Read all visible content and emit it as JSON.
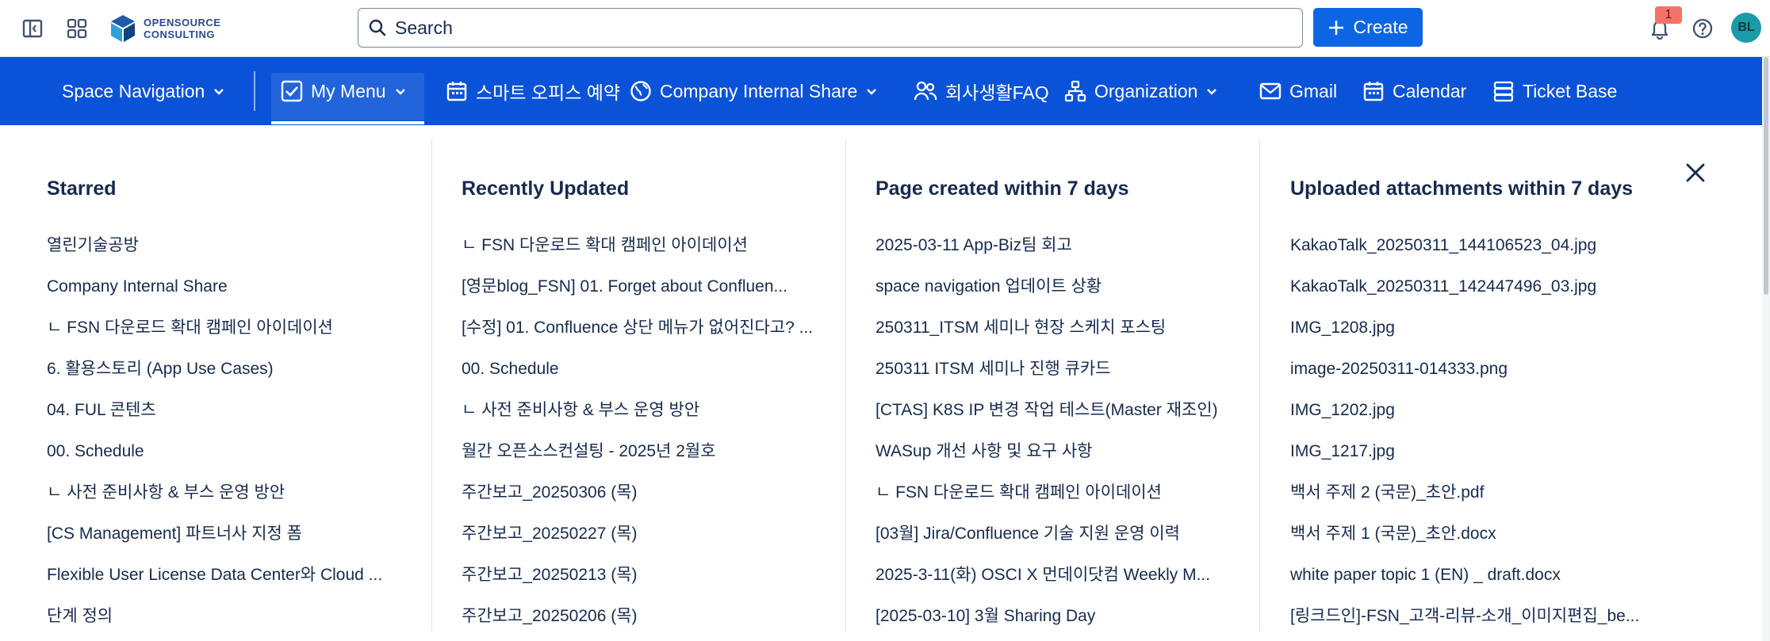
{
  "topbar": {
    "logo_line1": "OPENSOURCE",
    "logo_line2": "CONSULTING",
    "search_placeholder": "Search",
    "create_label": "Create",
    "notification_count": "1",
    "avatar_initials": "BL"
  },
  "nav": {
    "space_navigation": "Space Navigation",
    "my_menu": "My Menu",
    "smart_office": "스마트 오피스 예약",
    "company_internal_share": "Company Internal Share",
    "faq": "회사생활FAQ",
    "organization": "Organization",
    "gmail": "Gmail",
    "calendar": "Calendar",
    "ticket_base": "Ticket Base"
  },
  "columns": [
    {
      "title": "Starred",
      "items": [
        "열린기술공방",
        "Company Internal Share",
        "ㄴ FSN 다운로드 확대 캠페인 아이데이션",
        "6. 활용스토리 (App Use Cases)",
        "04. FUL 콘텐츠",
        "00. Schedule",
        "ㄴ 사전 준비사항 & 부스 운영 방안",
        "[CS Management] 파트너사 지정 폼",
        "Flexible User License Data Center와 Cloud ...",
        "단계 정의"
      ]
    },
    {
      "title": "Recently Updated",
      "items": [
        "ㄴ FSN 다운로드 확대 캠페인 아이데이션",
        "[영문blog_FSN] 01. Forget about Confluen...",
        "[수정] 01. Confluence 상단 메뉴가 없어진다고? ...",
        "00. Schedule",
        "ㄴ 사전 준비사항 & 부스 운영 방안",
        "월간 오픈소스컨설팅 - 2025년 2월호",
        "주간보고_20250306 (목)",
        "주간보고_20250227 (목)",
        "주간보고_20250213 (목)",
        "주간보고_20250206 (목)"
      ]
    },
    {
      "title": "Page created within 7 days",
      "items": [
        "2025-03-11 App-Biz팀 회고",
        "space navigation 업데이트 상황",
        "250311_ITSM 세미나 현장 스케치 포스팅",
        "250311 ITSM 세미나 진행 큐카드",
        "[CTAS] K8S IP 변경 작업 테스트(Master 재조인)",
        "WASup 개선 사항 및 요구 사항",
        "ㄴ FSN 다운로드 확대 캠페인 아이데이션",
        "[03월] Jira/Confluence 기술 지원 운영 이력",
        "2025-3-11(화) OSCI X 먼데이닷컴 Weekly M...",
        "[2025-03-10] 3월 Sharing Day"
      ]
    },
    {
      "title": "Uploaded attachments within 7 days",
      "items": [
        "KakaoTalk_20250311_144106523_04.jpg",
        "KakaoTalk_20250311_142447496_03.jpg",
        "IMG_1208.jpg",
        "image-20250311-014333.png",
        "IMG_1202.jpg",
        "IMG_1217.jpg",
        "백서 주제 2 (국문)_초안.pdf",
        "백서 주제 1 (국문)_초안.docx",
        "white paper topic 1 (EN) _ draft.docx",
        "[링크드인]-FSN_고객-리뷰-소개_이미지편집_be..."
      ]
    }
  ],
  "colors": {
    "nav_blue": "#0a53d9",
    "create_blue": "#0c66e4",
    "badge_red": "#f87168",
    "avatar_teal": "#1d9aaa"
  }
}
